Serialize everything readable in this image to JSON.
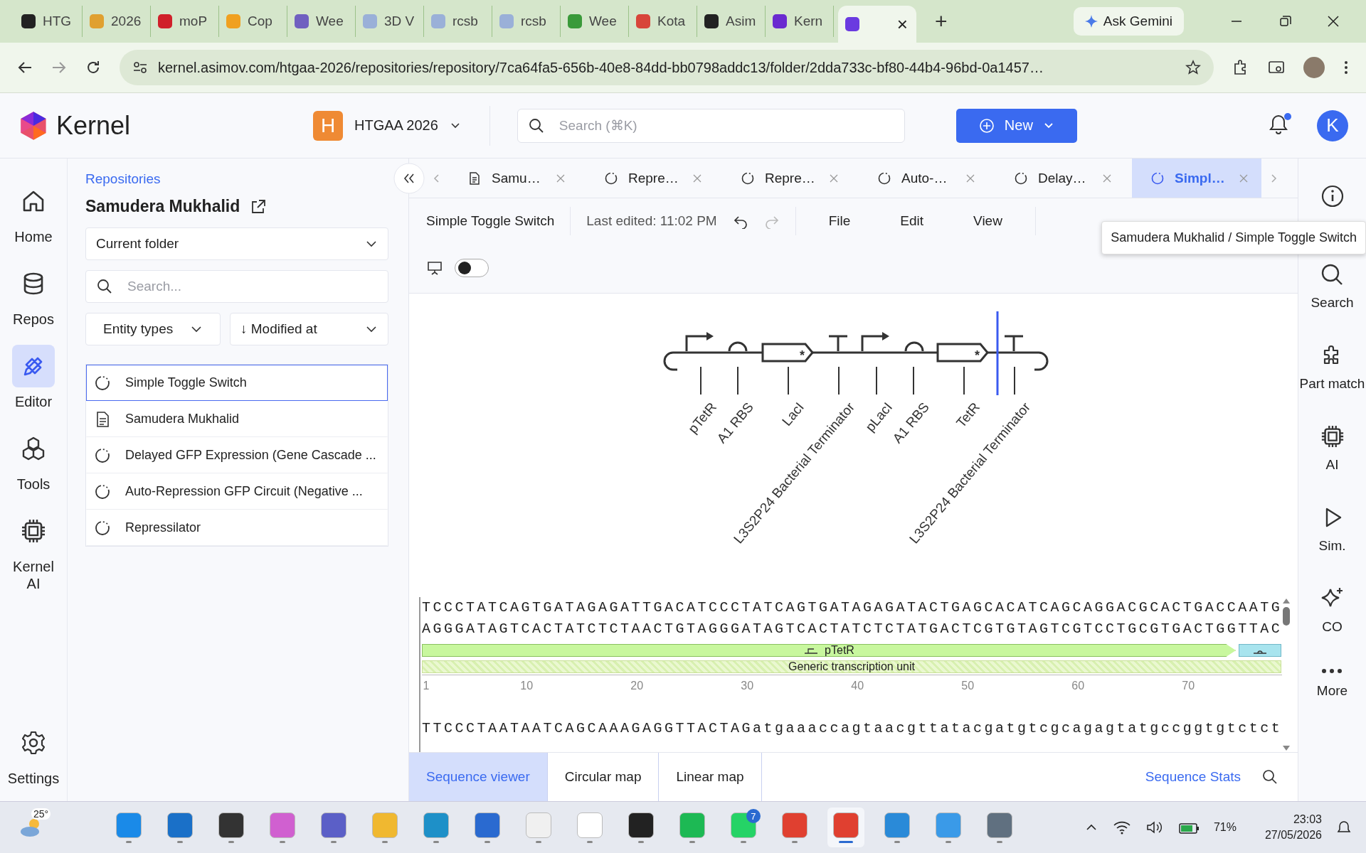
{
  "browser": {
    "tabs": [
      {
        "title": "HTG",
        "color": "#222222",
        "selected": false
      },
      {
        "title": "2026",
        "color": "#e0a030",
        "selected": false
      },
      {
        "title": "moP",
        "color": "#d0202a",
        "selected": false
      },
      {
        "title": "Cop",
        "color": "#f0a020",
        "selected": false
      },
      {
        "title": "Wee",
        "color": "#7060c0",
        "selected": false
      },
      {
        "title": "3D V",
        "color": "#9ab0d8",
        "selected": false
      },
      {
        "title": "rcsb",
        "color": "#9ab0d8",
        "selected": false
      },
      {
        "title": "rcsb",
        "color": "#9ab0d8",
        "selected": false
      },
      {
        "title": "Wee",
        "color": "#3a9a3a",
        "selected": false
      },
      {
        "title": "Kota",
        "color": "#d8453a",
        "selected": false
      },
      {
        "title": "Asim",
        "color": "#222222",
        "selected": false
      },
      {
        "title": "Kern",
        "color": "#6a2ad0",
        "selected": false
      },
      {
        "close": "×",
        "color": "#6a3ae0",
        "selected": true
      }
    ],
    "new_tab": "+",
    "gemini": "Ask Gemini",
    "url": "kernel.asimov.com/htgaa-2026/repositories/repository/7ca64fa5-656b-40e8-84dd-bb0798addc13/folder/2dda733c-bf80-44b4-96bd-0a1457…"
  },
  "header": {
    "logo": "Kernel",
    "workspace_initial": "H",
    "workspace": "HTGAA 2026",
    "search_placeholder": "Search (⌘K)",
    "new_button": "New",
    "notification": true,
    "avatar": "K"
  },
  "nav": [
    {
      "label": "Home",
      "kind": "home",
      "selected": false
    },
    {
      "label": "Repos",
      "kind": "repos",
      "selected": false
    },
    {
      "label": "Editor",
      "kind": "editor",
      "selected": true
    },
    {
      "label": "Tools",
      "kind": "tools",
      "selected": false
    },
    {
      "label": "Kernel AI",
      "kind": "chip",
      "selected": false
    }
  ],
  "nav_settings": "Settings",
  "sidebar": {
    "breadcrumb": "Repositories",
    "title": "Samudera Mukhalid",
    "scope": "Current folder",
    "search_placeholder": "Search...",
    "filters": [
      "Entity types",
      "↓ Modified at"
    ],
    "items": [
      {
        "name": "Simple Toggle Switch",
        "kind": "design",
        "selected": true
      },
      {
        "name": "Samudera Mukhalid",
        "kind": "document",
        "selected": false
      },
      {
        "name": "Delayed GFP Expression (Gene Cascade ...",
        "kind": "design",
        "selected": false
      },
      {
        "name": "Auto-Repression GFP Circuit (Negative ...",
        "kind": "design",
        "selected": false
      },
      {
        "name": "Repressilator",
        "kind": "design",
        "selected": false
      }
    ]
  },
  "editor": {
    "tabs": [
      {
        "title": "Samu…",
        "kind": "document",
        "selected": false
      },
      {
        "title": "Repre…",
        "kind": "design",
        "selected": false
      },
      {
        "title": "Repre…",
        "kind": "design",
        "selected": false
      },
      {
        "title": "Auto-…",
        "kind": "design",
        "selected": false
      },
      {
        "title": "Delay…",
        "kind": "design",
        "selected": false
      },
      {
        "title": "Simpl…",
        "kind": "design",
        "selected": true
      }
    ],
    "document_title": "Simple Toggle Switch",
    "last_edited": "Last edited: 11:02 PM",
    "menus": [
      "File",
      "Edit",
      "View"
    ],
    "tooltip": "Samudera Mukhalid / Simple Toggle Switch",
    "toggle_on": false,
    "parts": [
      {
        "kind": "promoter",
        "label": "pTetR"
      },
      {
        "kind": "rbs",
        "label": "A1 RBS"
      },
      {
        "kind": "cds",
        "label": "LacI",
        "marker": "*"
      },
      {
        "kind": "terminator",
        "label": "L3S2P24 Bacterial Terminator"
      },
      {
        "kind": "promoter",
        "label": "pLacI"
      },
      {
        "kind": "rbs",
        "label": "A1 RBS"
      },
      {
        "kind": "cds",
        "label": "TetR",
        "marker": "*"
      },
      {
        "kind": "terminator",
        "label": "L3S2P24 Bacterial Terminator"
      }
    ],
    "sequence": {
      "top": "TCCCTATCAGTGATAGAGATTGACATCCCTATCAGTGATAGAGATACTGAGCACATCAGCAGGACGCACTGACCAATG",
      "bottom": "AGGGATAGTCACTATCTCTAACTGTAGGGATAGTCACTATCTCTATGACTCGTGTAGTCGTCCTGCGTGACTGGTTAC",
      "features": [
        {
          "label": "pTetR",
          "kind": "promoter",
          "color": "#c8f79e"
        },
        {
          "kind": "rbs",
          "color": "#a8e4ee"
        }
      ],
      "unit": "Generic transcription unit",
      "ticks": [
        "1",
        "10",
        "20",
        "30",
        "40",
        "50",
        "60",
        "70"
      ],
      "next": "TTCCCTAATAATCAGCAAAGAGGTTACTAGatgaaaccagtaacgttatacgatgtcgcagagtatgccggtgtctct"
    },
    "bottom_tabs": [
      {
        "label": "Sequence viewer",
        "selected": true
      },
      {
        "label": "Circular map",
        "selected": false
      },
      {
        "label": "Linear map",
        "selected": false
      }
    ],
    "stats": "Sequence Stats"
  },
  "rail": [
    {
      "kind": "info"
    },
    {
      "kind": "search",
      "label": "Search"
    },
    {
      "kind": "puzzle",
      "label": "Part match"
    },
    {
      "kind": "chip",
      "label": "AI"
    },
    {
      "kind": "play",
      "label": "Sim."
    },
    {
      "kind": "sparkle",
      "label": "CO"
    },
    {
      "kind": "dots",
      "label": "More"
    }
  ],
  "taskbar": {
    "weather": "25°",
    "apps": [
      {
        "color": "#1a8ae8",
        "selected": false
      },
      {
        "color": "#1a70c8",
        "selected": false
      },
      {
        "color": "#333333",
        "selected": false
      },
      {
        "color": "#d060d0",
        "selected": false
      },
      {
        "color": "#5b5fc7",
        "selected": false
      },
      {
        "color": "#f0b830",
        "selected": false
      },
      {
        "color": "#1e90c8",
        "selected": false
      },
      {
        "color": "#2a6ad0",
        "selected": false
      },
      {
        "color": "#f0f0f0",
        "selected": false
      },
      {
        "color": "#ffffff",
        "selected": false
      },
      {
        "color": "#222222",
        "selected": false
      },
      {
        "color": "#1db954",
        "selected": false
      },
      {
        "color": "#25d366",
        "badge": "7",
        "selected": false
      },
      {
        "color": "#e04030",
        "selected": false
      },
      {
        "color": "#e04030",
        "selected": true
      },
      {
        "color": "#2a8ad8",
        "selected": false
      },
      {
        "color": "#3a9ae8",
        "selected": false
      },
      {
        "color": "#607080",
        "selected": false
      }
    ],
    "battery": "71%",
    "time": "23:03",
    "date": "27/05/2026"
  }
}
